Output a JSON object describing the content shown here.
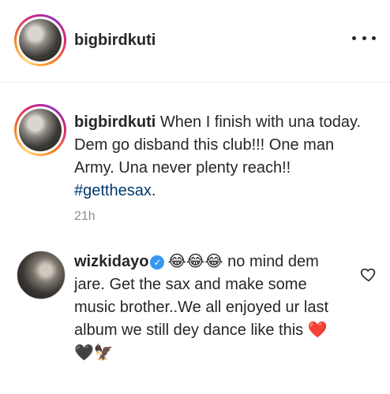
{
  "post_header": {
    "username": "bigbirdkuti",
    "more_icon": "more-horizontal-icon"
  },
  "caption": {
    "username": "bigbirdkuti",
    "text": "When I finish with una today. Dem go disband this club!!! One man Army. Una never plenty reach!!",
    "hashtag": "#getthesax",
    "trailing": ".",
    "time": "21h"
  },
  "comment": {
    "username": "wizkidayo",
    "verified_icon": "verified-badge-icon",
    "lead_emoji": "😂😂😂",
    "text": "no mind dem jare. Get the sax and make some music brother..We all enjoyed ur last album we still dey dance like this",
    "trail_emoji": "❤️🖤🦅",
    "like_icon": "heart-outline-icon"
  }
}
